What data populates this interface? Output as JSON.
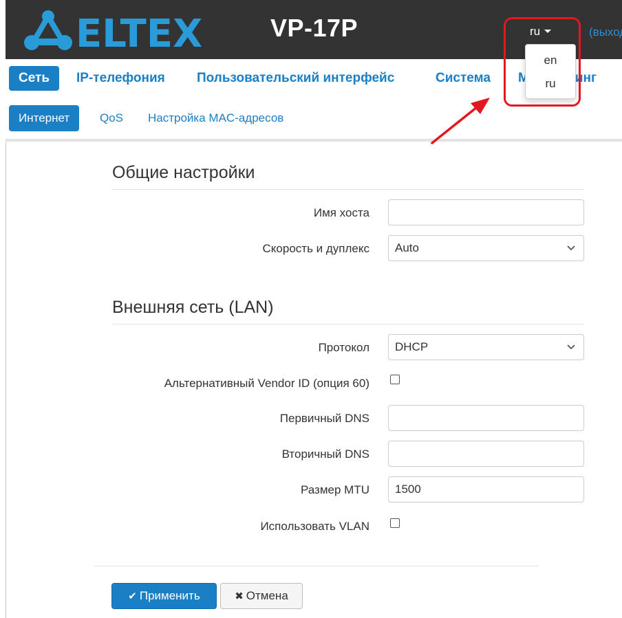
{
  "header": {
    "brand": "ELTEX",
    "model": "VP-17P",
    "language_current": "ru",
    "logout_label": "(выход)"
  },
  "language_menu": {
    "options": [
      "en",
      "ru"
    ]
  },
  "main_nav": {
    "tabs": [
      {
        "label": "Сеть",
        "active": true
      },
      {
        "label": "IP-телефония"
      },
      {
        "label": "Пользовательский интерфейс"
      },
      {
        "label": "Система"
      },
      {
        "label": "Мониторинг"
      }
    ]
  },
  "sub_nav": {
    "tabs": [
      {
        "label": "Интернет",
        "active": true
      },
      {
        "label": "QoS"
      },
      {
        "label": "Настройка MAC-адресов"
      }
    ]
  },
  "general": {
    "title": "Общие настройки",
    "hostname_label": "Имя хоста",
    "hostname_value": "",
    "speed_label": "Скорость и дуплекс",
    "speed_value": "Auto"
  },
  "lan": {
    "title": "Внешняя сеть (LAN)",
    "protocol_label": "Протокол",
    "protocol_value": "DHCP",
    "vendor_label": "Альтернативный Vendor ID (опция 60)",
    "vendor_checked": false,
    "dns1_label": "Первичный DNS",
    "dns1_value": "",
    "dns2_label": "Вторичный DNS",
    "dns2_value": "",
    "mtu_label": "Размер MTU",
    "mtu_value": "1500",
    "vlan_label": "Использовать VLAN",
    "vlan_checked": false
  },
  "actions": {
    "apply_label": "Применить",
    "cancel_label": "Отмена"
  },
  "colors": {
    "header_bg": "#333333",
    "accent": "#1b7fc6",
    "highlight": "#e5161d",
    "logo": "#2a9bd9"
  }
}
